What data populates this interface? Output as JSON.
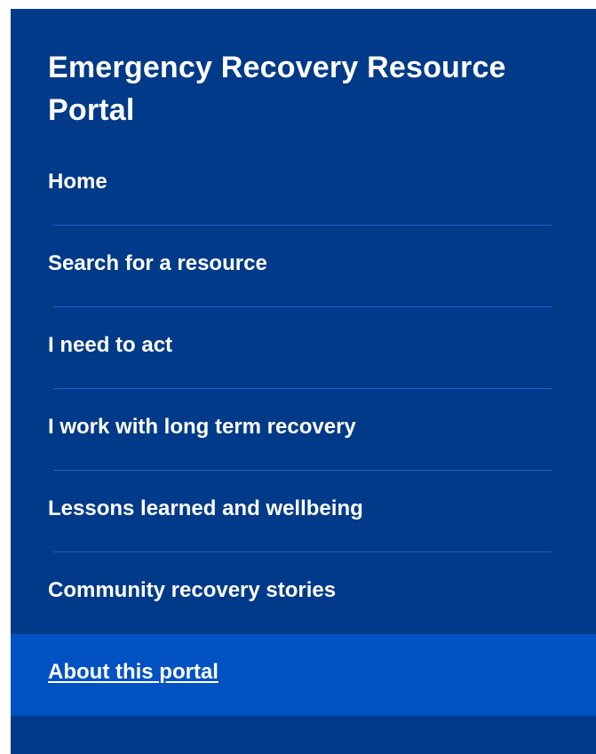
{
  "sidebar": {
    "title": "Emergency Recovery Resource Portal",
    "items": [
      {
        "label": "Home"
      },
      {
        "label": "Search for a resource"
      },
      {
        "label": "I need to act"
      },
      {
        "label": "I work with long term recovery"
      },
      {
        "label": "Lessons learned and wellbeing"
      },
      {
        "label": "Community recovery stories"
      },
      {
        "label": "About this portal",
        "active": true
      }
    ]
  },
  "colors": {
    "panel_background": "#003a88",
    "active_item_background": "#0052c2",
    "divider": "#1f5fcf",
    "text": "#ffffff"
  }
}
